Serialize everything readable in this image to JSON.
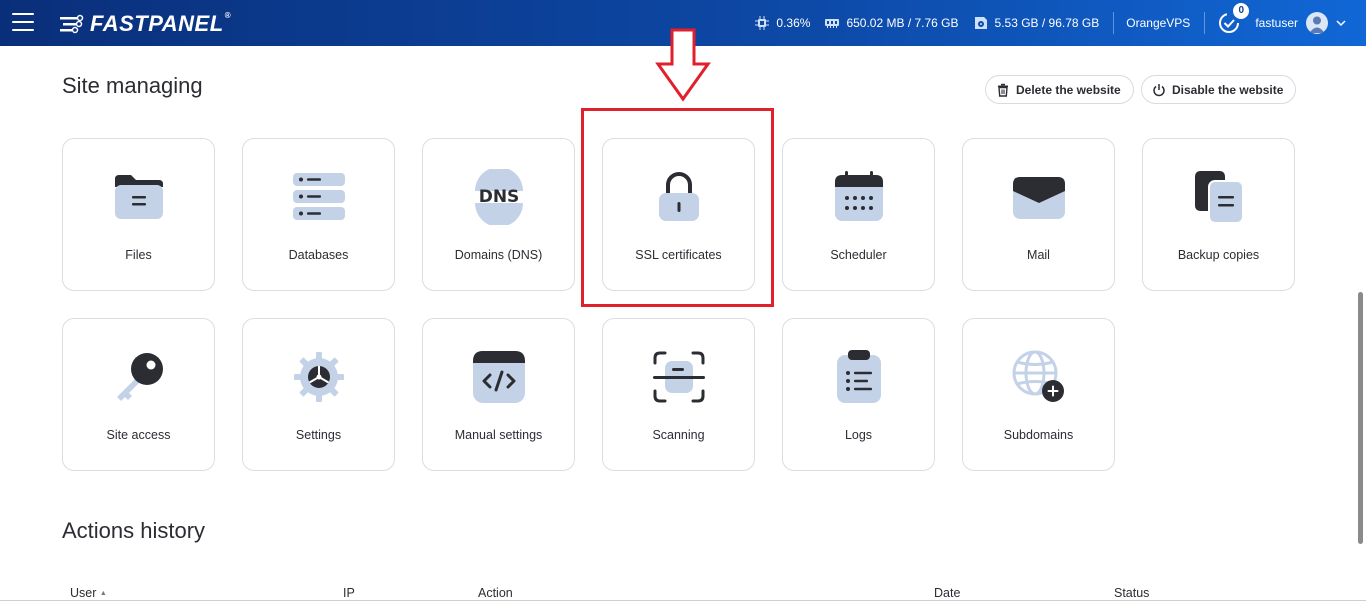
{
  "topbar": {
    "logo_text": "FASTPANEL",
    "logo_reg": "®",
    "cpu": "0.36%",
    "ram": "650.02 MB / 7.76 GB",
    "disk": "5.53 GB / 96.78 GB",
    "provider": "OrangeVPS",
    "notification_count": "0",
    "username": "fastuser"
  },
  "site_managing": {
    "title": "Site managing",
    "delete_label": "Delete the website",
    "disable_label": "Disable the website",
    "cards": [
      {
        "label": "Files",
        "icon": "folder-icon"
      },
      {
        "label": "Databases",
        "icon": "database-icon"
      },
      {
        "label": "Domains (DNS)",
        "icon": "dns-icon"
      },
      {
        "label": "SSL certificates",
        "icon": "lock-icon"
      },
      {
        "label": "Scheduler",
        "icon": "calendar-icon"
      },
      {
        "label": "Mail",
        "icon": "mail-icon"
      },
      {
        "label": "Backup copies",
        "icon": "copies-icon"
      },
      {
        "label": "Site access",
        "icon": "key-icon"
      },
      {
        "label": "Settings",
        "icon": "gear-icon"
      },
      {
        "label": "Manual settings",
        "icon": "code-icon"
      },
      {
        "label": "Scanning",
        "icon": "scan-icon"
      },
      {
        "label": "Logs",
        "icon": "clipboard-list-icon"
      },
      {
        "label": "Subdomains",
        "icon": "globe-plus-icon"
      }
    ]
  },
  "actions_history": {
    "title": "Actions history",
    "columns": [
      "User",
      "IP",
      "Action",
      "Date",
      "Status"
    ],
    "sort_indicator": "▲"
  },
  "colors": {
    "topbar_start": "#0a2f7a",
    "topbar_end": "#1167d6",
    "icon_light": "#c4d2e8",
    "icon_dark": "#2b2d33",
    "highlight": "#e0202a"
  }
}
